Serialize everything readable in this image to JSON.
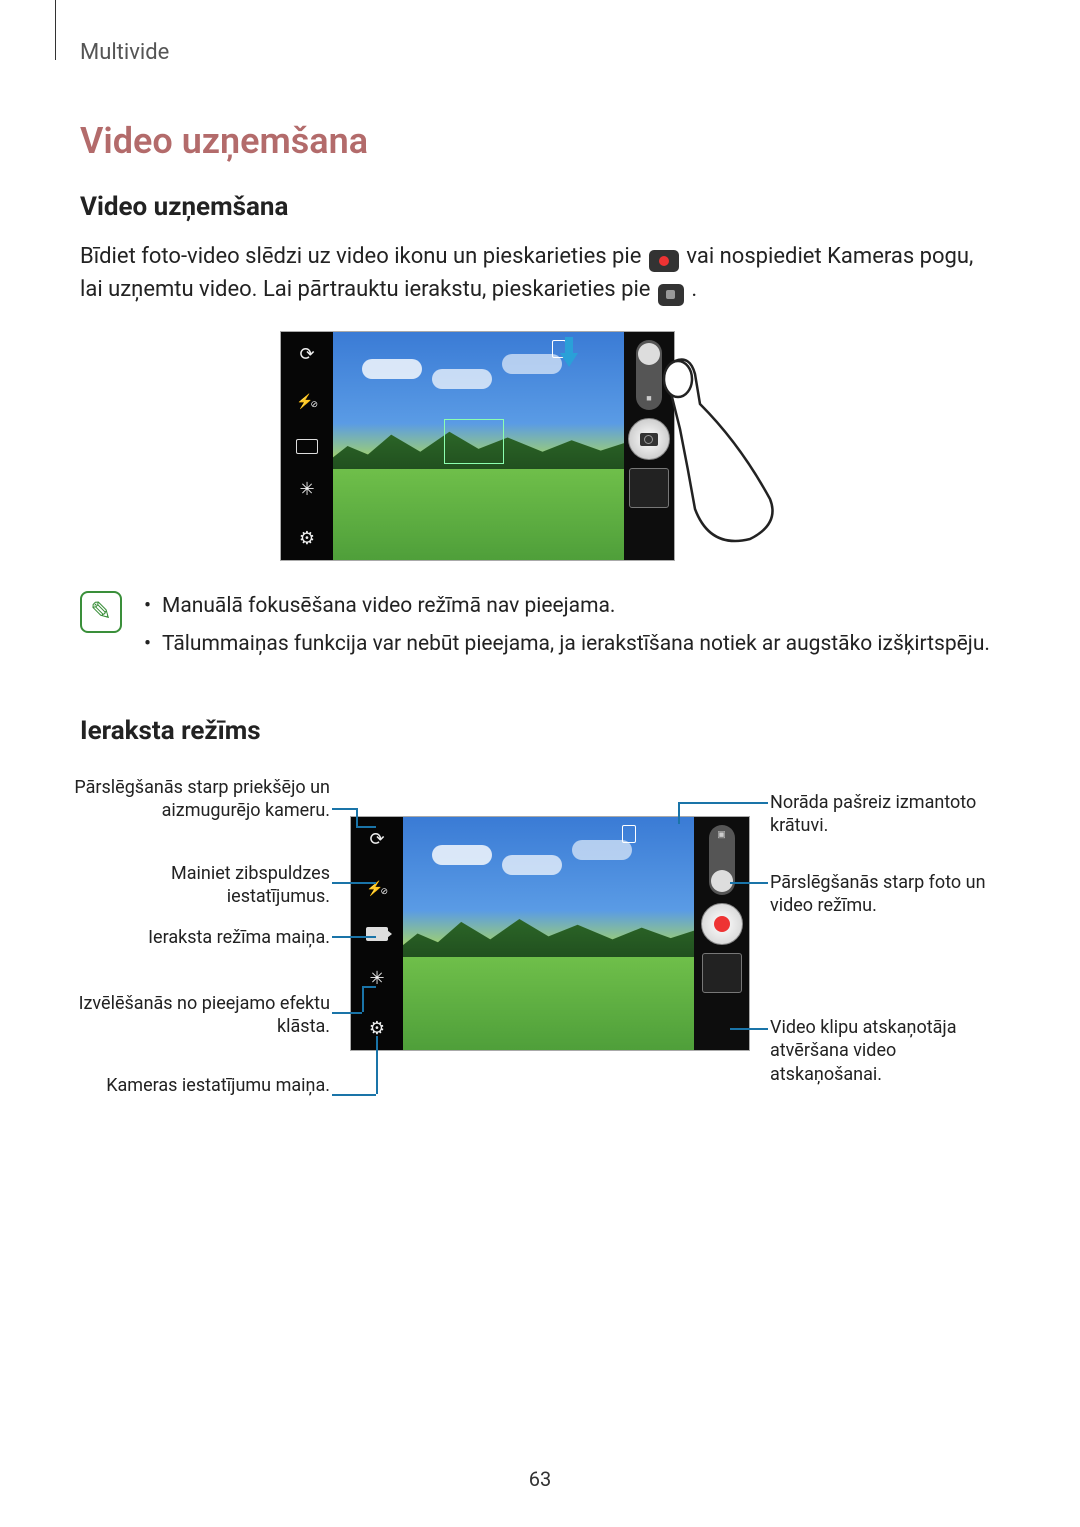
{
  "breadcrumb": "Multivide",
  "h1": "Video uzņemšana",
  "h2_rec": "Video uzņemšana",
  "body_pre": "Bīdiet foto-video slēdzi uz video ikonu un pieskarieties pie ",
  "body_mid": " vai nospiediet Kameras pogu, lai uzņemtu video. Lai pārtrauktu ierakstu, pieskarieties pie ",
  "body_end": ".",
  "notes": [
    "Manuālā fokusēšana video režīmā nav pieejama.",
    "Tālummaiņas funkcija var nebūt pieejama, ja ierakstīšana notiek ar augstāko izšķirtspēju."
  ],
  "h2_mode": "Ieraksta režīms",
  "callouts": {
    "switch_cam": "Pārslēgšanās starp priekšējo un aizmugurējo kameru.",
    "flash": "Mainiet zibspuldzes iestatījumus.",
    "rec_mode": "Ieraksta režīma maiņa.",
    "effects": "Izvēlēšanās no pieejamo efektu klāsta.",
    "settings": "Kameras iestatījumu maiņa.",
    "storage": "Norāda pašreiz izmantoto krātuvi.",
    "toggle": "Pārslēgšanās starp foto un video režīmu.",
    "player": "Video klipu atskaņotāja atvēršana video atskaņošanai."
  },
  "page_number": "63"
}
